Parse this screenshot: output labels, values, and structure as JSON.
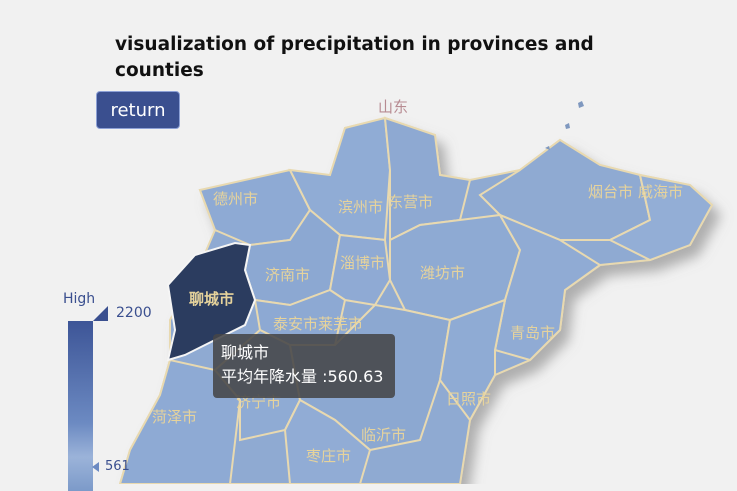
{
  "title": "visualization of precipitation in provinces and counties",
  "return_label": "return",
  "province_label": "山东",
  "city_labels": [
    "德州市",
    "滨州市",
    "东营市",
    "烟台市",
    "威海市",
    "济南市",
    "淄博市",
    "潍坊市",
    "泰安市",
    "莱芜市",
    "青岛市",
    "聊城市",
    "菏泽市",
    "济宁市",
    "日照市",
    "临沂市",
    "枣庄市"
  ],
  "highlighted_city": "聊城市",
  "legend": {
    "high_label": "High",
    "max_value": "2200",
    "min_value": "561"
  },
  "tooltip": {
    "city": "聊城市",
    "value_text": "平均年降水量 :560.63"
  },
  "colors": {
    "region_fill": "#8faad2",
    "highlight_fill": "#2b3c5f",
    "border": "#e8d9b0",
    "legend_dark": "#3a4f8f",
    "label": "#e6d39c"
  }
}
